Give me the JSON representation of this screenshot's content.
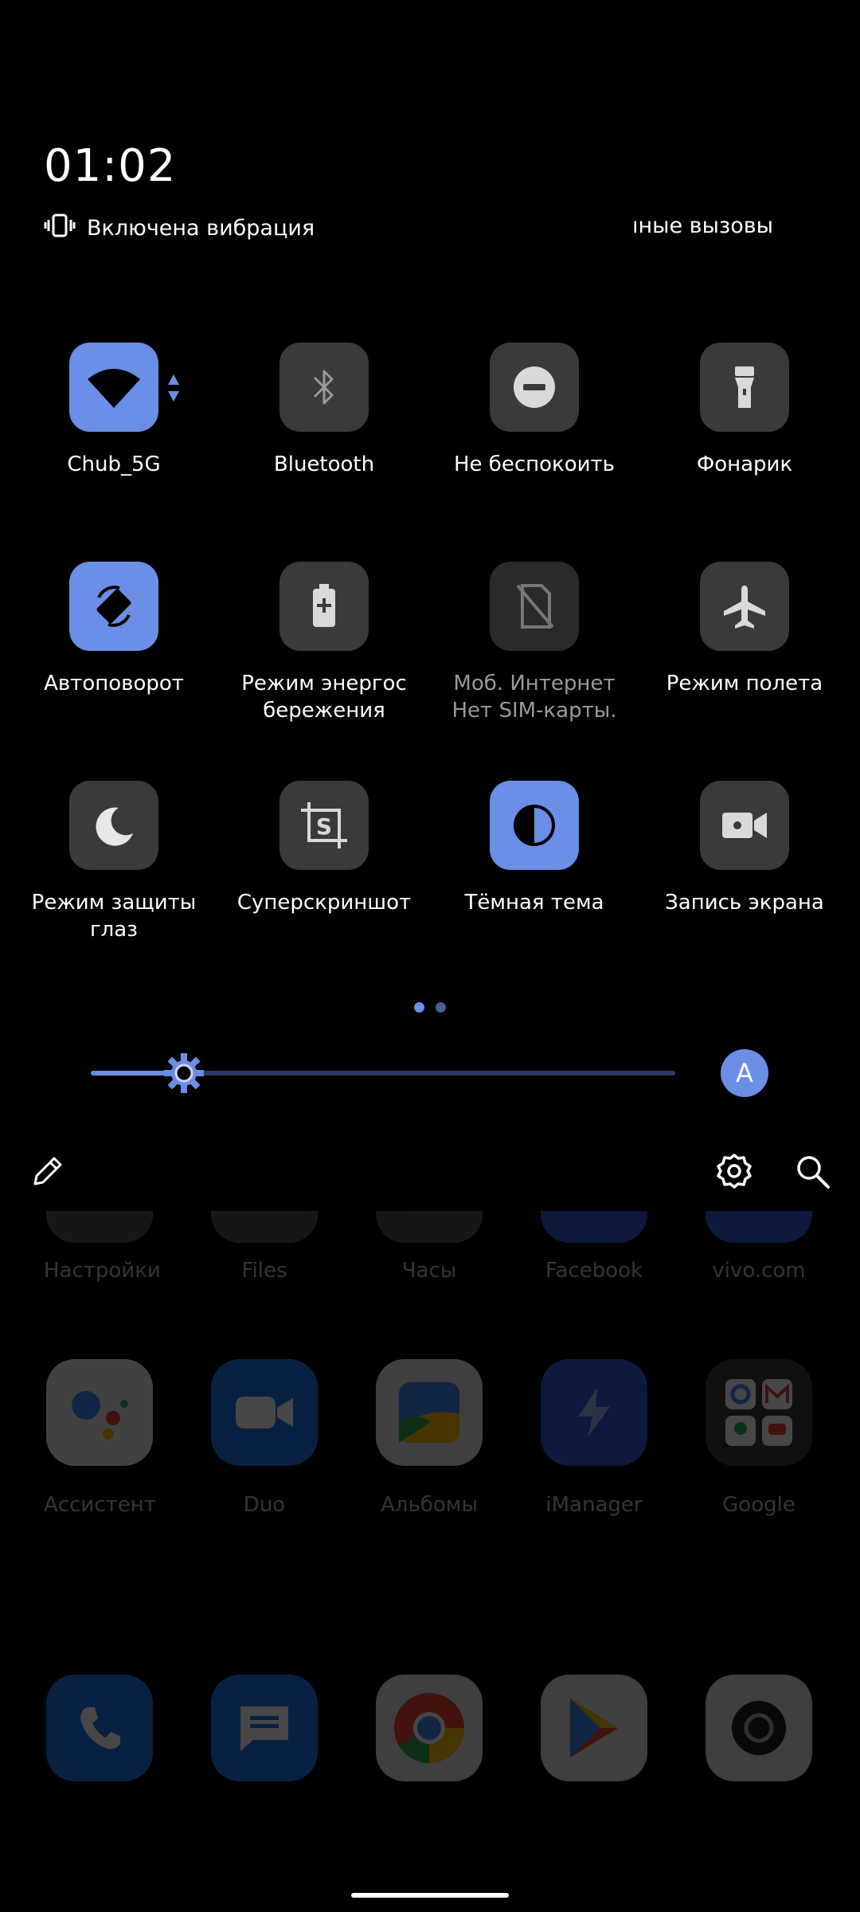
{
  "status": {
    "time": "01:02",
    "vibration_text": "Включена вибрация",
    "calls_text": "ıные вызовы"
  },
  "tiles": [
    {
      "label": "Chub_5G",
      "state": "active",
      "icon": "wifi-icon"
    },
    {
      "label": "Bluetooth",
      "state": "off",
      "icon": "bluetooth-icon"
    },
    {
      "label": "Не беспокоить",
      "state": "off",
      "icon": "do-not-disturb-icon"
    },
    {
      "label": "Фонарик",
      "state": "off",
      "icon": "flashlight-icon"
    },
    {
      "label": "Автоповорот",
      "state": "active",
      "icon": "auto-rotate-icon"
    },
    {
      "label": "Режим энергос бережения",
      "label_line1": "Режим энергос",
      "label_line2": "бережения",
      "state": "off",
      "icon": "battery-saver-icon"
    },
    {
      "label": "Моб. Интернет",
      "sub": "Нет SIM-карты.",
      "state": "disabled",
      "icon": "no-sim-icon"
    },
    {
      "label": "Режим полета",
      "state": "off",
      "icon": "airplane-icon"
    },
    {
      "label": "Режим защиты глаз",
      "label_line1": "Режим защиты",
      "label_line2": "глаз",
      "state": "off",
      "icon": "moon-icon"
    },
    {
      "label": "Суперскриншот",
      "state": "off",
      "icon": "super-screenshot-icon"
    },
    {
      "label": "Тёмная тема",
      "state": "active",
      "icon": "dark-theme-icon"
    },
    {
      "label": "Запись экрана",
      "state": "off",
      "icon": "screen-record-icon"
    }
  ],
  "pager": {
    "pages": 2,
    "current": 1
  },
  "brightness": {
    "level": 0.16,
    "auto_label": "A"
  },
  "colors": {
    "accent": "#6b8ee6",
    "tile_off": "#3a3a3a",
    "background": "#000000"
  },
  "home": {
    "row1": [
      "Настройки",
      "Files",
      "Часы",
      "Facebook",
      "vivo.com"
    ],
    "row2": [
      "Ассистент",
      "Duo",
      "Альбомы",
      "iManager",
      "Google"
    ],
    "dock": [
      "phone-icon",
      "messages-icon",
      "chrome-icon",
      "play-store-icon",
      "camera-icon"
    ]
  }
}
